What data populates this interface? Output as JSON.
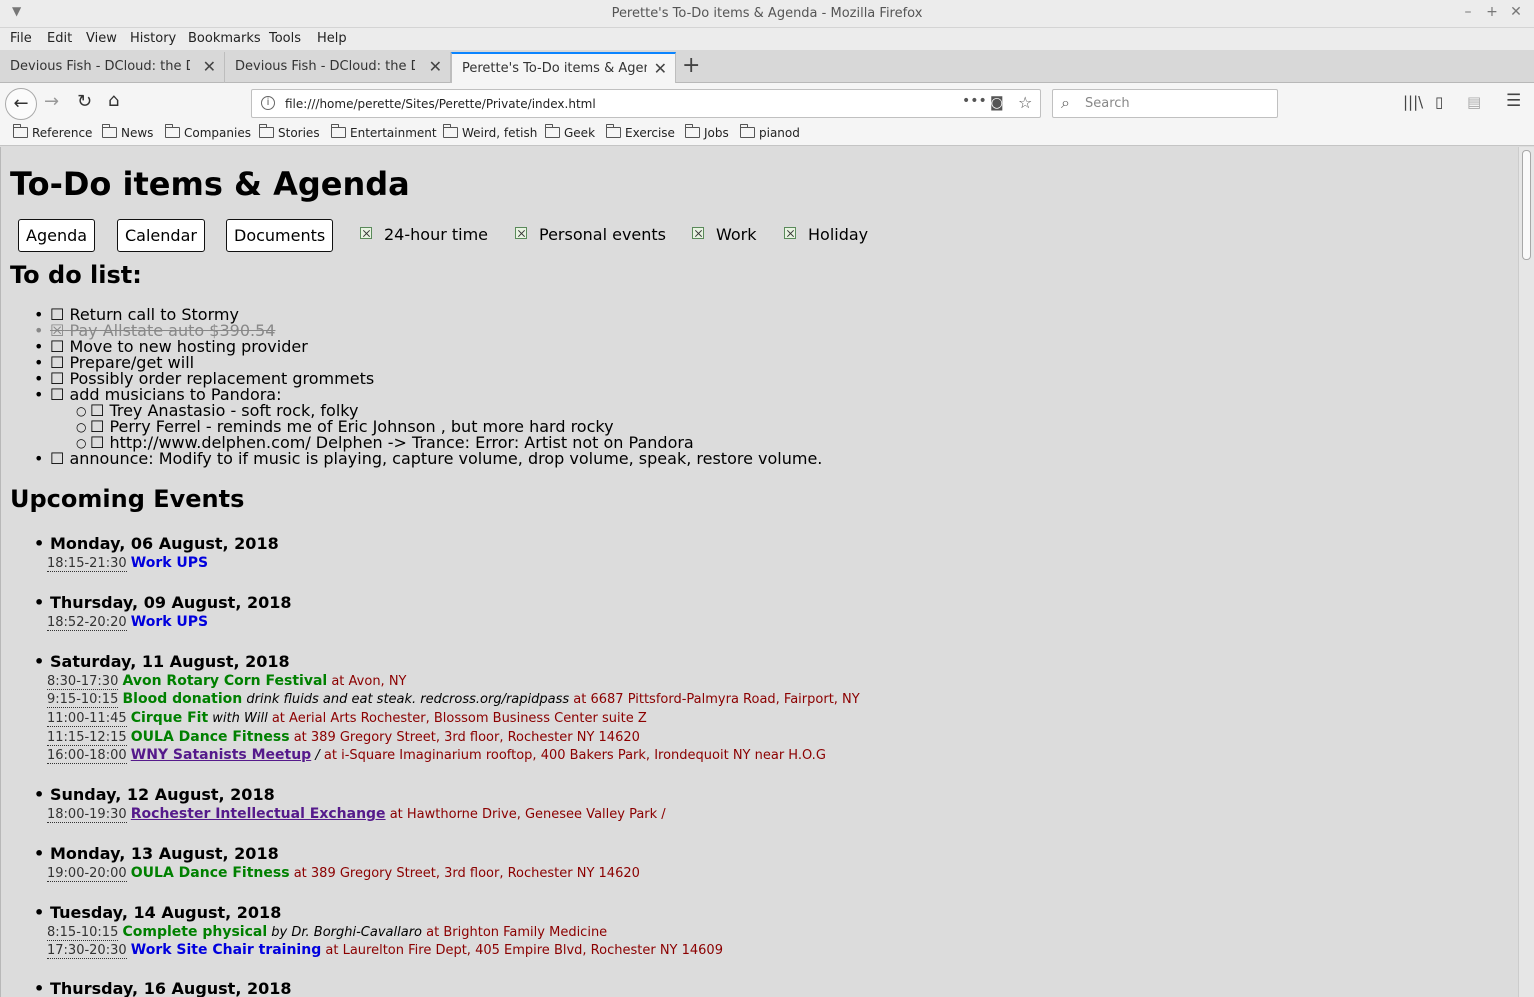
{
  "window": {
    "title": "Perette's To-Do items & Agenda - Mozilla Firefox"
  },
  "menubar": [
    "File",
    "Edit",
    "View",
    "History",
    "Bookmarks",
    "Tools",
    "Help"
  ],
  "tabs": [
    {
      "label": "Devious Fish - DCloud: the Devious Fish",
      "active": false
    },
    {
      "label": "Devious Fish - DCloud: the Devious Fish",
      "active": false
    },
    {
      "label": "Perette's To-Do items & Agenda",
      "active": true
    }
  ],
  "navbar": {
    "url": "file:///home/perette/Sites/Perette/Private/index.html",
    "search_placeholder": "Search"
  },
  "bookmarks": [
    "Reference",
    "News",
    "Companies",
    "Stories",
    "Entertainment",
    "Weird, fetish",
    "Geek",
    "Exercise",
    "Jobs",
    "pianod"
  ],
  "page": {
    "title": "To-Do items & Agenda",
    "buttons": [
      "Agenda",
      "Calendar",
      "Documents"
    ],
    "toggles": [
      "24-hour time",
      "Personal events",
      "Work",
      "Holiday"
    ],
    "todo_heading": "To do list:",
    "todo": [
      {
        "text": "Return call to Stormy",
        "done": false,
        "level": 1
      },
      {
        "text": "Pay Allstate auto $390.54",
        "done": true,
        "level": 1
      },
      {
        "text": "Move to new hosting provider",
        "done": false,
        "level": 1
      },
      {
        "text": "Prepare/get will",
        "done": false,
        "level": 1
      },
      {
        "text": "Possibly order replacement grommets",
        "done": false,
        "level": 1
      },
      {
        "text": "add musicians to Pandora:",
        "done": false,
        "level": 1
      },
      {
        "text": "Trey Anastasio - soft rock, folky",
        "done": false,
        "level": 2
      },
      {
        "text": "Perry Ferrel - reminds me of Eric Johnson , but more hard rocky",
        "done": false,
        "level": 2
      },
      {
        "text": "http://www.delphen.com/ Delphen -> Trance: Error: Artist not on Pandora",
        "done": false,
        "level": 2
      },
      {
        "text": "announce: Modify to if music is playing, capture volume, drop volume, speak, restore volume.",
        "done": false,
        "level": 1
      }
    ],
    "events_heading": "Upcoming Events",
    "days": [
      {
        "date": "Monday, 06 August, 2018",
        "events": [
          {
            "time": "18:15-21:30",
            "name": "Work UPS",
            "style": "blue"
          }
        ]
      },
      {
        "date": "Thursday, 09 August, 2018",
        "events": [
          {
            "time": "18:52-20:20",
            "name": "Work UPS",
            "style": "blue"
          }
        ]
      },
      {
        "date": "Saturday, 11 August, 2018",
        "events": [
          {
            "time": "8:30-17:30",
            "name": "Avon Rotary Corn Festival",
            "style": "green",
            "location": "at Avon, NY"
          },
          {
            "time": "9:15-10:15",
            "name": "Blood donation",
            "style": "green",
            "note": "drink fluids and eat steak. redcross.org/rapidpass",
            "location": "at 6687 Pittsford-Palmyra Road, Fairport, NY"
          },
          {
            "time": "11:00-11:45",
            "name": "Cirque Fit",
            "style": "green",
            "note": "with Will",
            "location": "at Aerial Arts Rochester, Blossom Business Center suite Z"
          },
          {
            "time": "11:15-12:15",
            "name": "OULA Dance Fitness",
            "style": "green",
            "location": "at 389 Gregory Street, 3rd floor, Rochester NY 14620"
          },
          {
            "time": "16:00-18:00",
            "name": "WNY Satanists Meetup",
            "style": "link",
            "note": "/",
            "location": "at i-Square Imaginarium rooftop, 400 Bakers Park, Irondequoit NY near H.O.G"
          }
        ]
      },
      {
        "date": "Sunday, 12 August, 2018",
        "events": [
          {
            "time": "18:00-19:30",
            "name": "Rochester Intellectual Exchange",
            "style": "link",
            "location": "at Hawthorne Drive, Genesee Valley Park /"
          }
        ]
      },
      {
        "date": "Monday, 13 August, 2018",
        "events": [
          {
            "time": "19:00-20:00",
            "name": "OULA Dance Fitness",
            "style": "green",
            "location": "at 389 Gregory Street, 3rd floor, Rochester NY 14620"
          }
        ]
      },
      {
        "date": "Tuesday, 14 August, 2018",
        "events": [
          {
            "time": "8:15-10:15",
            "name": "Complete physical",
            "style": "green",
            "note": "by Dr. Borghi-Cavallaro",
            "location": "at Brighton Family Medicine"
          },
          {
            "time": "17:30-20:30",
            "name": "Work Site Chair training",
            "style": "blue",
            "location": "at Laurelton Fire Dept, 405 Empire Blvd, Rochester NY 14609"
          }
        ]
      },
      {
        "date": "Thursday, 16 August, 2018",
        "events": []
      }
    ]
  }
}
